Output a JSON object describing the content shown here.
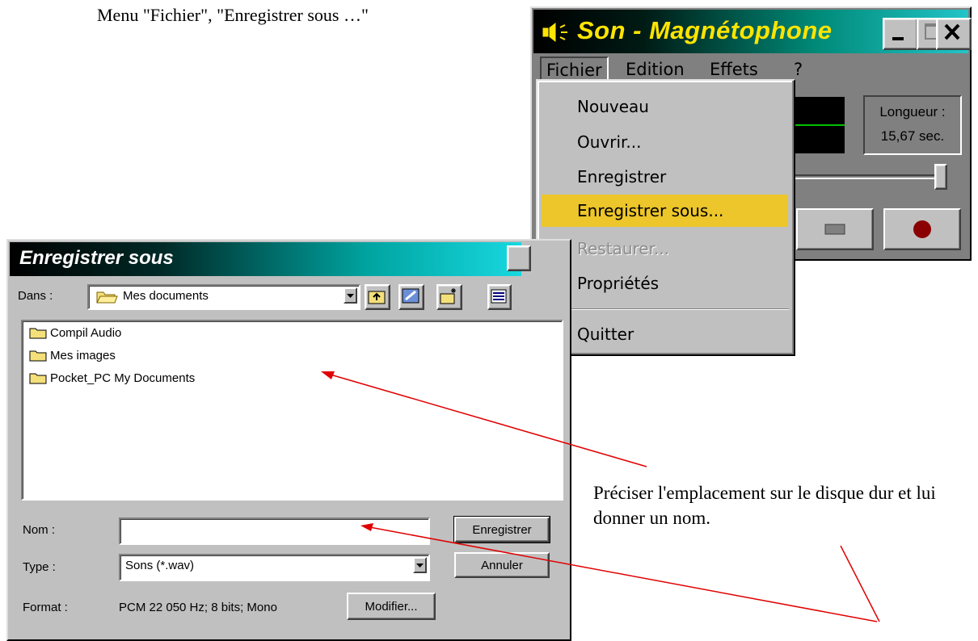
{
  "caption": "Menu \"Fichier\", \"Enregistrer sous …\"",
  "recorder": {
    "title": "Son - Magnétophone",
    "menus": [
      {
        "label": "Fichier"
      },
      {
        "label": "Edition"
      },
      {
        "label": "Effets"
      },
      {
        "label": "?"
      }
    ],
    "length_label": "Longueur :",
    "length_value": "15,67 sec."
  },
  "file_menu": {
    "items": [
      {
        "label": "Nouveau",
        "state": "normal"
      },
      {
        "label": "Ouvrir...",
        "state": "normal"
      },
      {
        "label": "Enregistrer",
        "state": "normal"
      },
      {
        "label": "Enregistrer sous...",
        "state": "highlighted"
      },
      {
        "label": "Restaurer...",
        "state": "disabled"
      },
      {
        "label": "Propriétés",
        "state": "normal"
      },
      {
        "label": "Quitter",
        "state": "normal"
      }
    ]
  },
  "save_dialog": {
    "title": "Enregistrer sous",
    "dans_label": "Dans :",
    "dans_value": "Mes documents",
    "folders": [
      {
        "name": "Compil Audio"
      },
      {
        "name": "Mes images"
      },
      {
        "name": "Pocket_PC My Documents"
      }
    ],
    "nom_label": "Nom :",
    "nom_value": "",
    "type_label": "Type :",
    "type_value": "Sons (*.wav)",
    "format_label": "Format :",
    "format_value": "PCM 22 050 Hz; 8 bits; Mono",
    "buttons": {
      "save": "Enregistrer",
      "cancel": "Annuler",
      "modify": "Modifier..."
    }
  },
  "annotation": {
    "text": "Préciser l'emplacement sur le disque dur et lui donner un nom."
  },
  "colors": {
    "window_face": "#c0c0c0",
    "recorder_face": "#808080",
    "menu_highlight": "#ecc62a",
    "title_text_recorder": "#ffe400",
    "annotation_arrow": "#e00000",
    "record_dot": "#8b0000"
  }
}
